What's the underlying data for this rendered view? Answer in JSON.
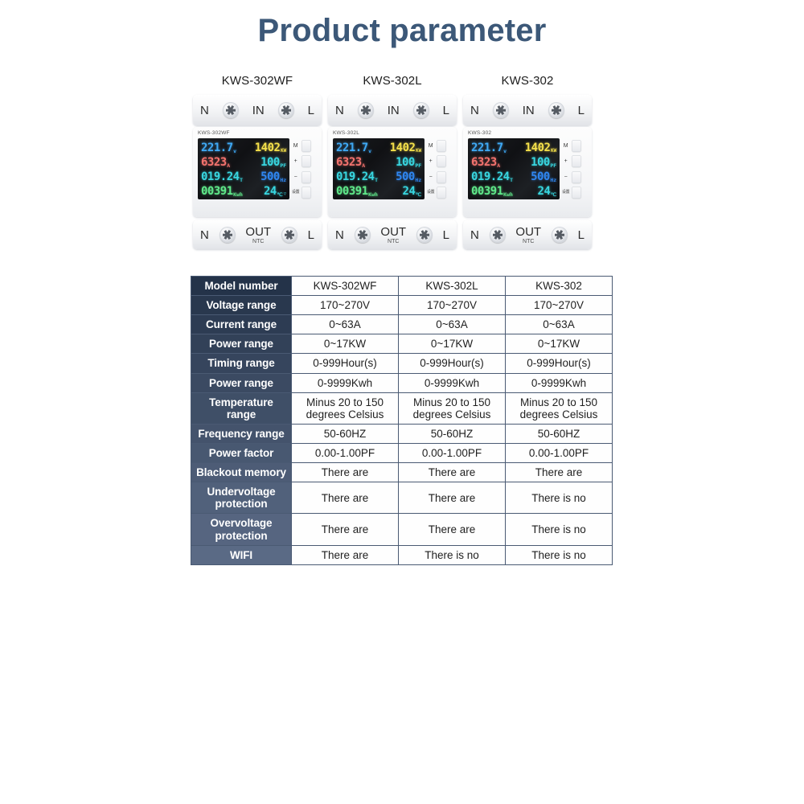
{
  "header": {
    "title": "Product parameter"
  },
  "devices": [
    {
      "caption": "KWS-302WF",
      "model_tag": "KWS-302WF",
      "terminals": {
        "top_left": "N",
        "top_mid": "IN",
        "top_right": "L",
        "bottom_left": "N",
        "bottom_mid": "OUT",
        "bottom_mid_sub": "NTC",
        "bottom_right": "L"
      },
      "lcd": {
        "voltage": "221.7",
        "voltage_unit": "v",
        "power": "1402",
        "power_unit": "KW",
        "current": "6323",
        "current_unit": "A",
        "pf": "100",
        "pf_unit": "PF",
        "time": "019.24",
        "time_unit": "T",
        "freq": "500",
        "freq_unit": "Hz",
        "energy": "00391",
        "energy_unit": "Kwh",
        "temp": "24",
        "temp_unit": "℃",
        "wifi_icon": "wifi-icon",
        "has_wifi": true
      },
      "buttons": [
        "M",
        "+",
        "−",
        "设置"
      ]
    },
    {
      "caption": "KWS-302L",
      "model_tag": "KWS-302L",
      "terminals": {
        "top_left": "N",
        "top_mid": "IN",
        "top_right": "L",
        "bottom_left": "N",
        "bottom_mid": "OUT",
        "bottom_mid_sub": "NTC",
        "bottom_right": "L"
      },
      "lcd": {
        "voltage": "221.7",
        "voltage_unit": "v",
        "power": "1402",
        "power_unit": "KW",
        "current": "6323",
        "current_unit": "A",
        "pf": "100",
        "pf_unit": "PF",
        "time": "019.24",
        "time_unit": "T",
        "freq": "500",
        "freq_unit": "Hz",
        "energy": "00391",
        "energy_unit": "Kwh",
        "temp": "24",
        "temp_unit": "℃",
        "wifi_icon": "wifi-icon",
        "has_wifi": false
      },
      "buttons": [
        "M",
        "+",
        "−",
        "设置"
      ]
    },
    {
      "caption": "KWS-302",
      "model_tag": "KWS-302",
      "terminals": {
        "top_left": "N",
        "top_mid": "IN",
        "top_right": "L",
        "bottom_left": "N",
        "bottom_mid": "OUT",
        "bottom_mid_sub": "NTC",
        "bottom_right": "L"
      },
      "lcd": {
        "voltage": "221.7",
        "voltage_unit": "v",
        "power": "1402",
        "power_unit": "KW",
        "current": "6323",
        "current_unit": "A",
        "pf": "100",
        "pf_unit": "PF",
        "time": "019.24",
        "time_unit": "T",
        "freq": "500",
        "freq_unit": "Hz",
        "energy": "00391",
        "energy_unit": "Kwh",
        "temp": "24",
        "temp_unit": "℃",
        "wifi_icon": "wifi-icon",
        "has_wifi": false
      },
      "buttons": [
        "M",
        "+",
        "−",
        "设置"
      ]
    }
  ],
  "table": {
    "rows": [
      {
        "label": "Model number",
        "values": [
          "KWS-302WF",
          "KWS-302L",
          "KWS-302"
        ]
      },
      {
        "label": "Voltage range",
        "values": [
          "170~270V",
          "170~270V",
          "170~270V"
        ]
      },
      {
        "label": "Current range",
        "values": [
          "0~63A",
          "0~63A",
          "0~63A"
        ]
      },
      {
        "label": "Power range",
        "values": [
          "0~17KW",
          "0~17KW",
          "0~17KW"
        ]
      },
      {
        "label": "Timing range",
        "values": [
          "0-999Hour(s)",
          "0-999Hour(s)",
          "0-999Hour(s)"
        ]
      },
      {
        "label": "Power range",
        "values": [
          "0-9999Kwh",
          "0-9999Kwh",
          "0-9999Kwh"
        ]
      },
      {
        "label": "Temperature range",
        "values": [
          "Minus 20 to 150\ndegrees Celsius",
          "Minus 20 to 150\ndegrees Celsius",
          "Minus 20 to 150\ndegrees Celsius"
        ]
      },
      {
        "label": "Frequency range",
        "values": [
          "50-60HZ",
          "50-60HZ",
          "50-60HZ"
        ]
      },
      {
        "label": "Power factor",
        "values": [
          "0.00-1.00PF",
          "0.00-1.00PF",
          "0.00-1.00PF"
        ]
      },
      {
        "label": "Blackout memory",
        "values": [
          "There are",
          "There are",
          "There are"
        ]
      },
      {
        "label": "Undervoltage protection",
        "values": [
          "There are",
          "There are",
          "There is no"
        ]
      },
      {
        "label": "Overvoltage protection",
        "values": [
          "There are",
          "There are",
          "There is no"
        ]
      },
      {
        "label": "WIFI",
        "values": [
          "There are",
          "There is no",
          "There is no"
        ]
      }
    ]
  },
  "colors": {
    "title": "#3c5878",
    "label_top": "#243349",
    "label_bottom": "#5a6a85",
    "border": "#4a5a73",
    "background": "#ffffff"
  }
}
